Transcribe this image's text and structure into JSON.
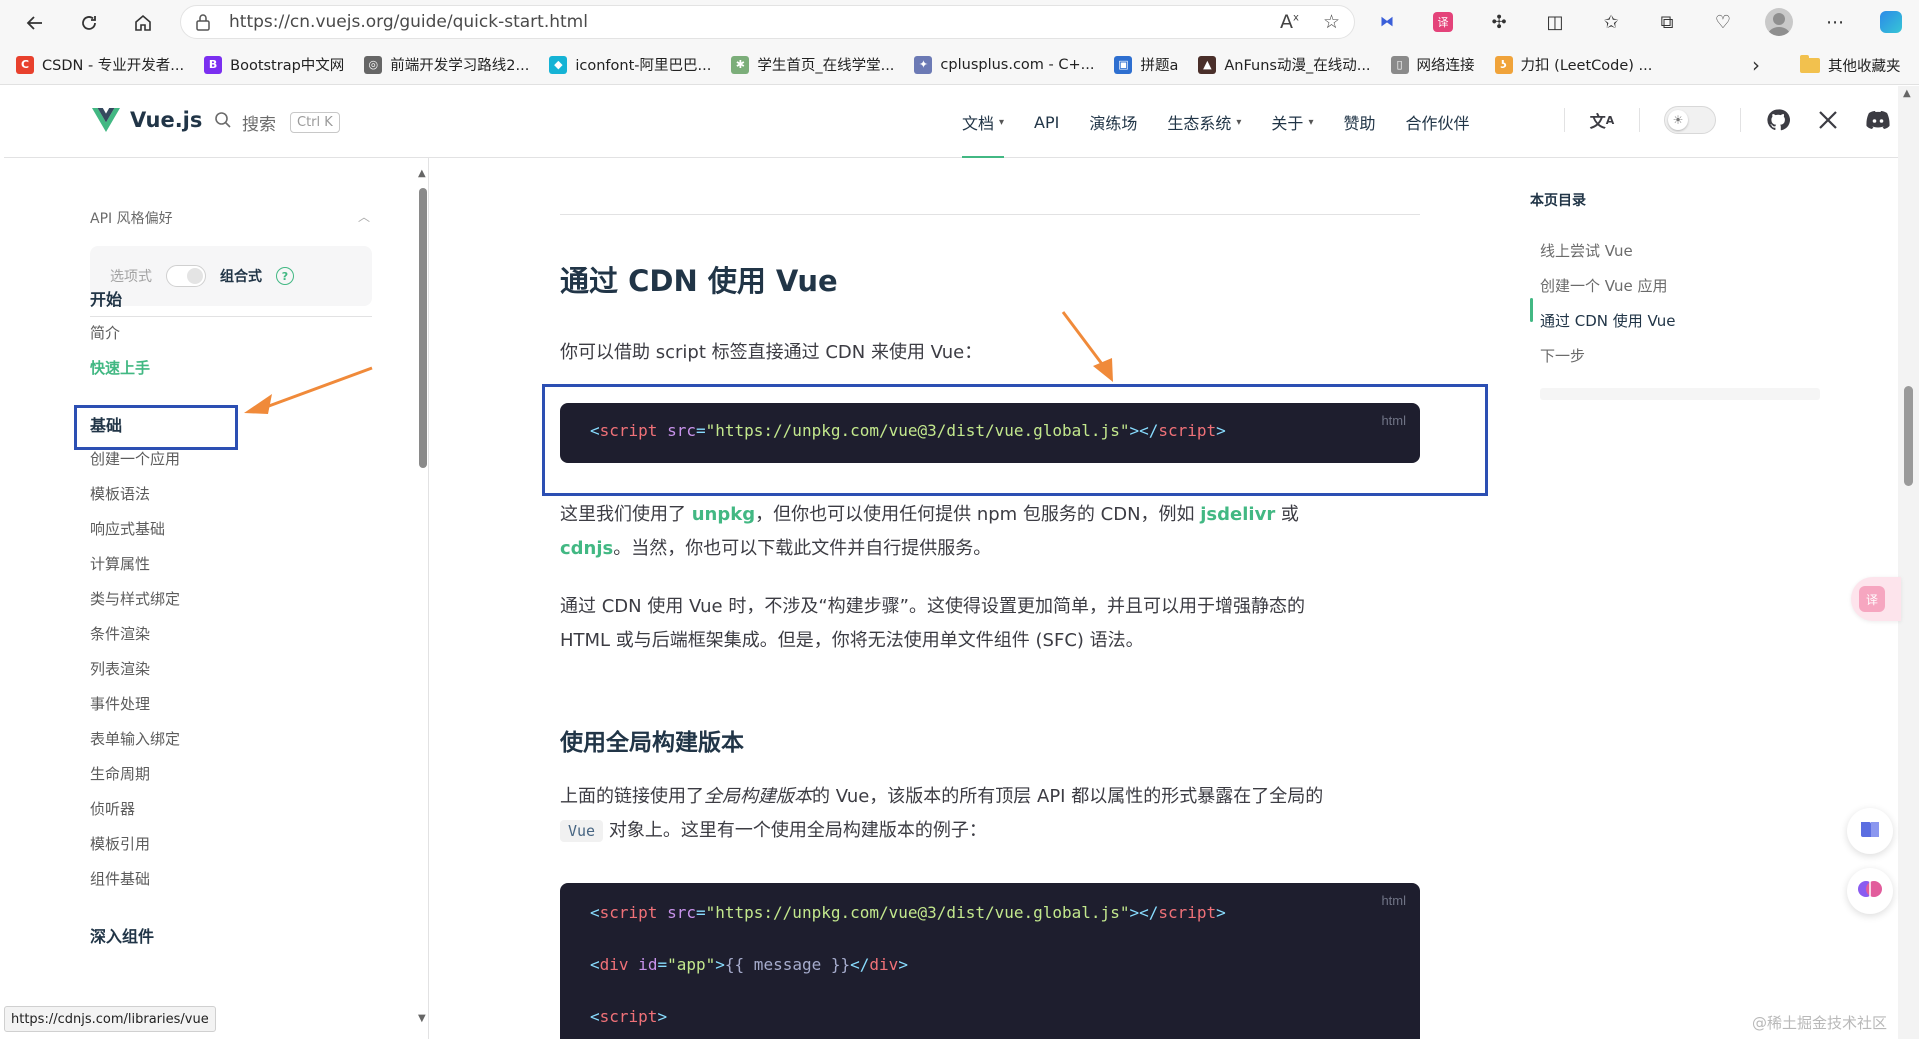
{
  "browser": {
    "url": "https://cn.vuejs.org/guide/quick-start.html",
    "bookmarks": [
      {
        "label": "CSDN - 专业开发者...",
        "icon": "csdn-icon",
        "color": "#e8412d",
        "glyph": "C"
      },
      {
        "label": "Bootstrap中文网",
        "icon": "bootstrap-icon",
        "color": "#7b2ff0",
        "glyph": "B"
      },
      {
        "label": "前端开发学习路线2...",
        "icon": "globe-icon",
        "color": "#666666",
        "glyph": "◎"
      },
      {
        "label": "iconfont-阿里巴巴...",
        "icon": "iconfont-icon",
        "color": "#15b3d5",
        "glyph": "◆"
      },
      {
        "label": "学生首页_在线学堂...",
        "icon": "school-icon",
        "color": "#7cae7a",
        "glyph": "✱"
      },
      {
        "label": "cplusplus.com - C+...",
        "icon": "cplusplus-icon",
        "color": "#6c7ab5",
        "glyph": "✦"
      },
      {
        "label": "拼题a",
        "icon": "pta-icon",
        "color": "#2e6fd0",
        "glyph": "▣"
      },
      {
        "label": "AnFuns动漫_在线动...",
        "icon": "anfuns-icon",
        "color": "#4a2f2a",
        "glyph": "▲"
      },
      {
        "label": "网络连接",
        "icon": "page-icon",
        "color": "#8a8a8a",
        "glyph": "▯"
      },
      {
        "label": "力扣 (LeetCode) ...",
        "icon": "leetcode-icon",
        "color": "#f0a33a",
        "glyph": "ʖ"
      }
    ],
    "other_bookmarks": "其他收藏夹",
    "status_url": "https://cdnjs.com/libraries/vue"
  },
  "site": {
    "logo_text": "Vue.js",
    "search_label": "搜索",
    "search_shortcut": "Ctrl K",
    "nav": [
      {
        "label": "文档",
        "dropdown": true,
        "active": true
      },
      {
        "label": "API",
        "dropdown": false,
        "active": false
      },
      {
        "label": "演练场",
        "dropdown": false,
        "active": false
      },
      {
        "label": "生态系统",
        "dropdown": true,
        "active": false
      },
      {
        "label": "关于",
        "dropdown": true,
        "active": false
      },
      {
        "label": "赞助",
        "dropdown": false,
        "active": false
      },
      {
        "label": "合作伙伴",
        "dropdown": false,
        "active": false
      }
    ],
    "accent_color": "#42b883"
  },
  "sidebar": {
    "pref_title": "API 风格偏好",
    "pref_options": "选项式",
    "pref_composition": "组合式",
    "sections": [
      {
        "title": "开始",
        "items": [
          "简介",
          "快速上手"
        ]
      },
      {
        "title": "基础",
        "items": [
          "创建一个应用",
          "模板语法",
          "响应式基础",
          "计算属性",
          "类与样式绑定",
          "条件渲染",
          "列表渲染",
          "事件处理",
          "表单输入绑定",
          "生命周期",
          "侦听器",
          "模板引用",
          "组件基础"
        ]
      },
      {
        "title": "深入组件",
        "items": []
      }
    ],
    "active_item": "快速上手"
  },
  "content": {
    "h2": "通过 CDN 使用 Vue",
    "p1": "你可以借助 script 标签直接通过 CDN 来使用 Vue：",
    "code1": {
      "lang": "html",
      "open": "<",
      "tag": "script",
      "attr": " src",
      "eq": "=",
      "str": "\"https://unpkg.com/vue@3/dist/vue.global.js\"",
      "close": "></",
      "tag2": "script",
      "end": ">"
    },
    "p2_a": "这里我们使用了 ",
    "p2_link1": "unpkg",
    "p2_b": "，但你也可以使用任何提供 npm 包服务的 CDN，例如 ",
    "p2_link2": "jsdelivr",
    "p2_c": " 或",
    "p2_link3": "cdnjs",
    "p2_d": "。当然，你也可以下载此文件并自行提供服务。",
    "p3_line1": "通过 CDN 使用 Vue 时，不涉及“构建步骤”。这使得设置更加简单，并且可以用于增强静态的",
    "p3_line2": "HTML 或与后端框架集成。但是，你将无法使用单文件组件 (SFC) 语法。",
    "h3": "使用全局构建版本",
    "p4_a": "上面的链接使用了",
    "p4_em": "全局构建版本",
    "p4_b": "的 Vue，该版本的所有顶层 API 都以属性的形式暴露在了全局的",
    "p4_code": "Vue",
    "p4_c": " 对象上。这里有一个使用全局构建版本的例子：",
    "code2": {
      "lang": "html",
      "line1_str": "\"https://unpkg.com/vue@3/dist/vue.global.js\"",
      "line2_attr": " id",
      "line2_str": "\"app\"",
      "line2_text": "{{ message }}",
      "tag_script": "script",
      "tag_div": "div"
    }
  },
  "toc": {
    "title": "本页目录",
    "items": [
      "线上尝试 Vue",
      "创建一个 Vue 应用",
      "通过 CDN 使用 Vue",
      "下一步"
    ],
    "active_index": 2
  },
  "watermark": "@稀土掘金技术社区"
}
